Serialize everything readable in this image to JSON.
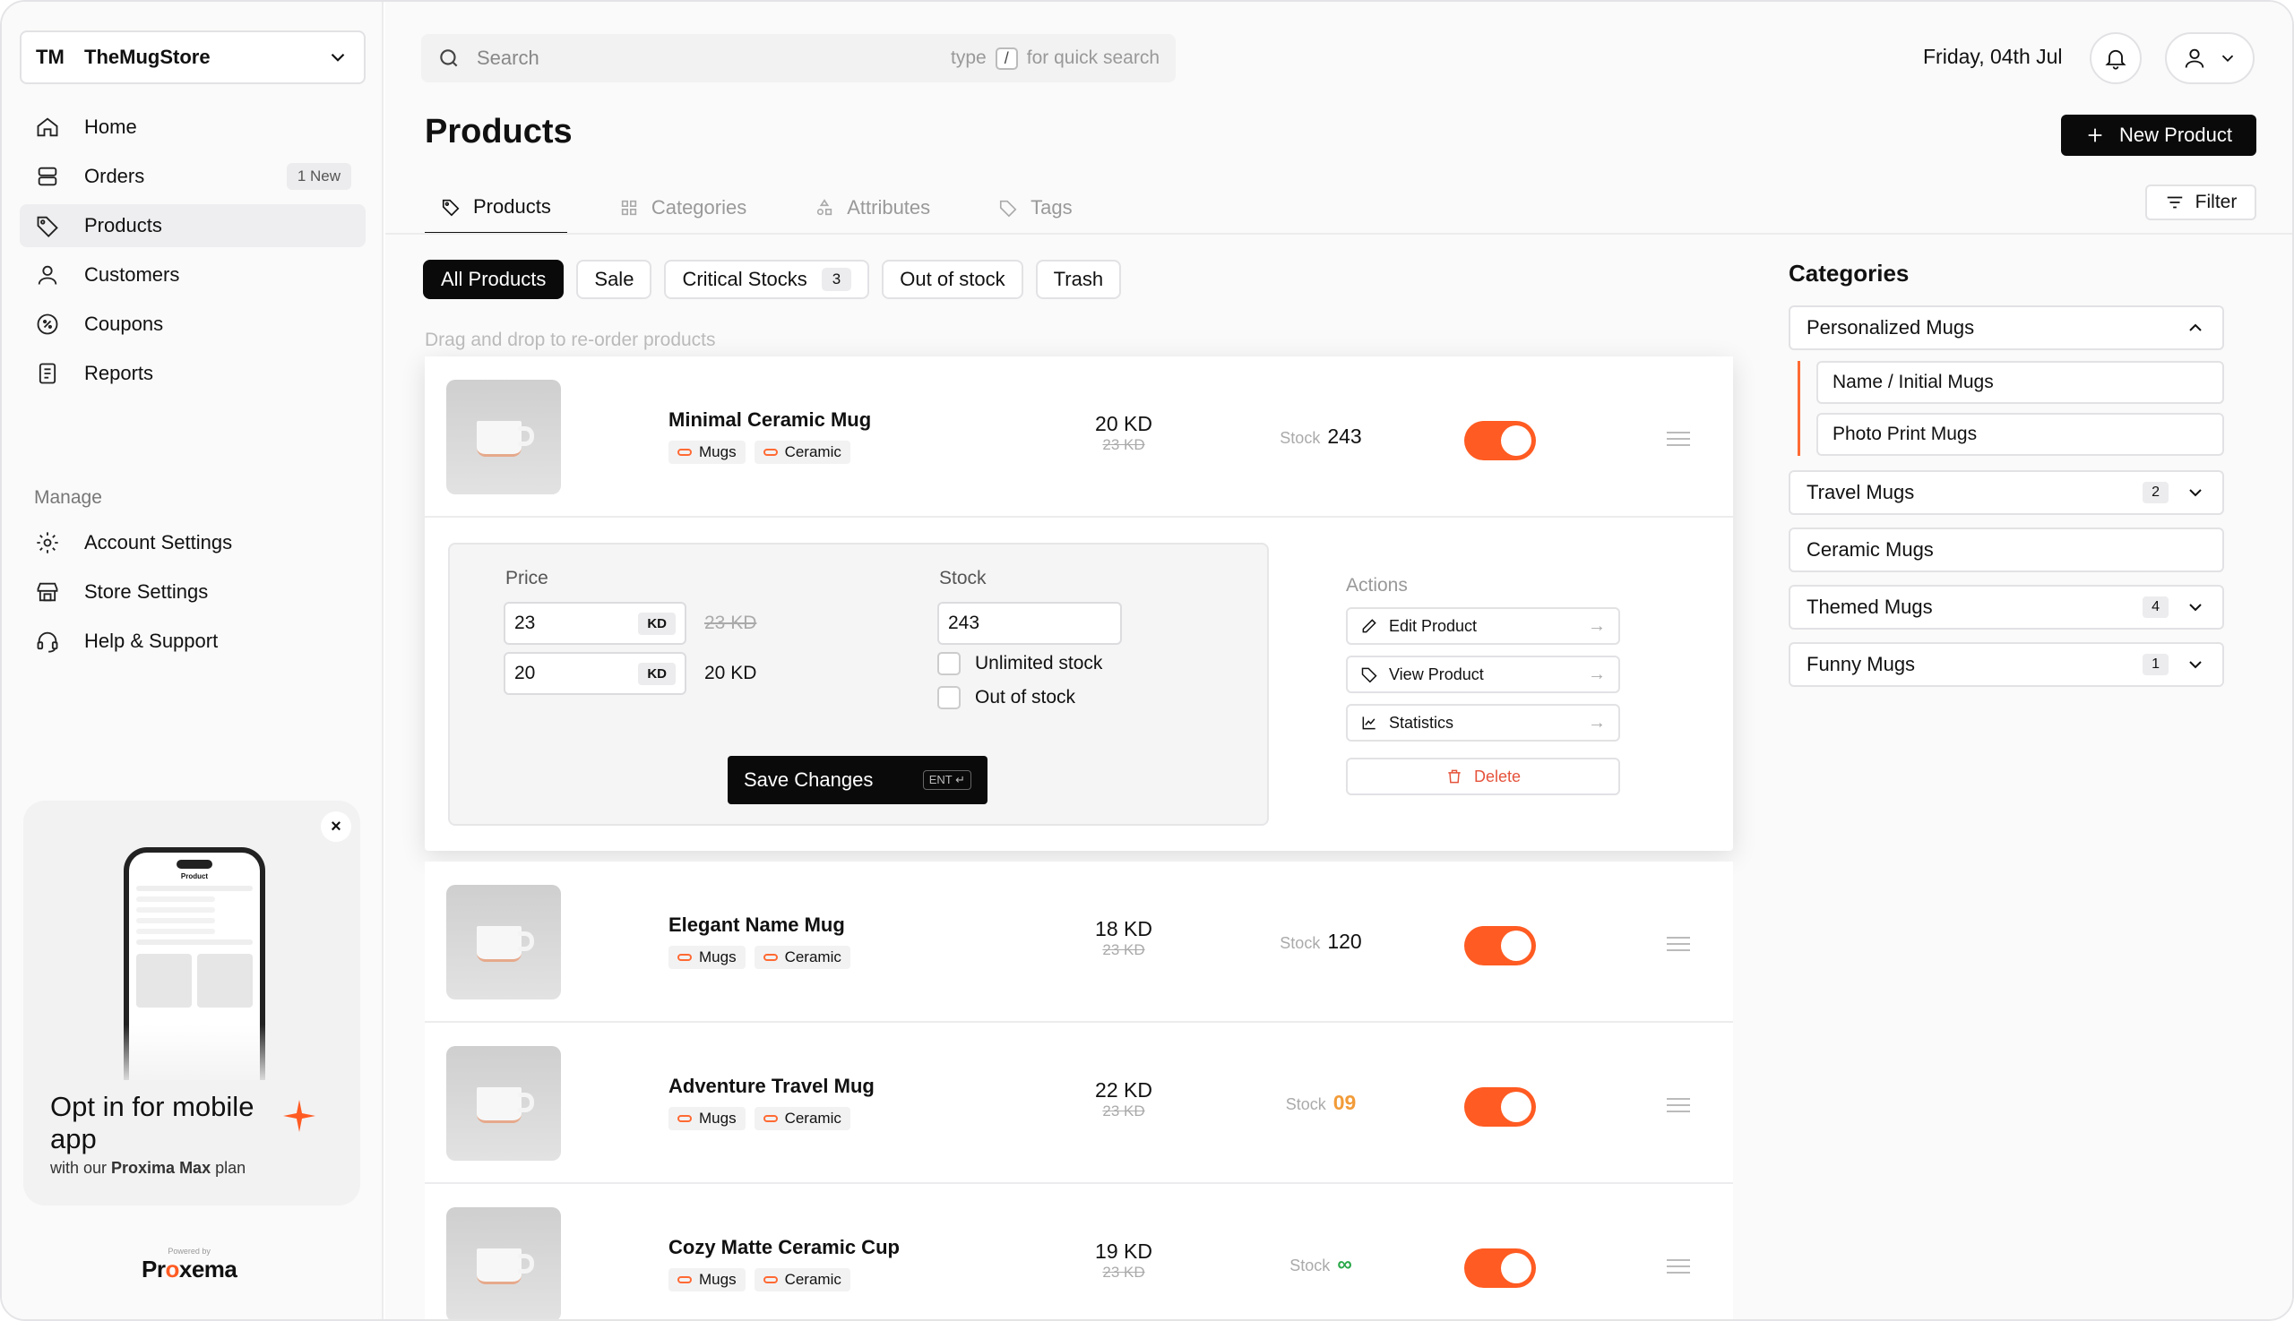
{
  "store": {
    "initials": "TM",
    "name": "TheMugStore"
  },
  "nav": {
    "home": "Home",
    "orders": "Orders",
    "orders_badge": "1 New",
    "products": "Products",
    "customers": "Customers",
    "coupons": "Coupons",
    "reports": "Reports",
    "manage_label": "Manage",
    "account_settings": "Account Settings",
    "store_settings": "Store Settings",
    "help": "Help & Support"
  },
  "promo": {
    "close": "×",
    "title": "Opt in for mobile app",
    "sub_prefix": "with our ",
    "sub_plan": "Proxima Max",
    "sub_suffix": " plan",
    "phone_title": "Product"
  },
  "powered": {
    "tiny": "Powered by",
    "logo_a": "Pr",
    "logo_o": "o",
    "logo_b": "xema"
  },
  "search": {
    "placeholder": "Search",
    "hint_pre": "type",
    "hint_key": "/",
    "hint_post": "for quick search"
  },
  "header": {
    "date": "Friday, 04th Jul",
    "title": "Products",
    "new_button": "New Product",
    "filter": "Filter"
  },
  "tabs": [
    "Products",
    "Categories",
    "Attributes",
    "Tags"
  ],
  "chips": {
    "all": "All Products",
    "sale": "Sale",
    "critical": "Critical Stocks",
    "critical_count": "3",
    "out": "Out of stock",
    "trash": "Trash"
  },
  "dnd_hint": "Drag and drop to re-order products",
  "products": [
    {
      "name": "Minimal Ceramic Mug",
      "tag1": "Mugs",
      "tag2": "Ceramic",
      "price": "20 KD",
      "old_price": "23 KD",
      "stock_label": "Stock",
      "stock": "243"
    },
    {
      "name": "Elegant Name Mug",
      "tag1": "Mugs",
      "tag2": "Ceramic",
      "price": "18 KD",
      "old_price": "23 KD",
      "stock_label": "Stock",
      "stock": "120"
    },
    {
      "name": "Adventure Travel Mug",
      "tag1": "Mugs",
      "tag2": "Ceramic",
      "price": "22 KD",
      "old_price": "23 KD",
      "stock_label": "Stock",
      "stock": "09"
    },
    {
      "name": "Cozy Matte Ceramic Cup",
      "tag1": "Mugs",
      "tag2": "Ceramic",
      "price": "19 KD",
      "old_price": "23 KD",
      "stock_label": "Stock",
      "stock": "∞"
    }
  ],
  "editor": {
    "price_label": "Price",
    "regular_price": "23",
    "unit": "KD",
    "regular_display": "23 KD",
    "sale_price": "20",
    "sale_display": "20 KD",
    "stock_label": "Stock",
    "stock_value": "243",
    "unlimited": "Unlimited stock",
    "out_of_stock": "Out of stock",
    "save": "Save Changes",
    "save_key": "ENT ↵",
    "actions_label": "Actions",
    "edit": "Edit Product",
    "view": "View Product",
    "stats": "Statistics",
    "delete": "Delete",
    "arrow": "→"
  },
  "categories": {
    "title": "Categories",
    "personalized": "Personalized Mugs",
    "sub1": "Name / Initial Mugs",
    "sub2": "Photo Print Mugs",
    "travel": "Travel Mugs",
    "travel_count": "2",
    "ceramic": "Ceramic Mugs",
    "themed": "Themed Mugs",
    "themed_count": "4",
    "funny": "Funny Mugs",
    "funny_count": "1"
  },
  "colors": {
    "accent": "#ff5b22",
    "dark": "#0a0a0a",
    "warn": "#f29b38",
    "ok": "#2aa84a",
    "danger": "#e5533b"
  }
}
